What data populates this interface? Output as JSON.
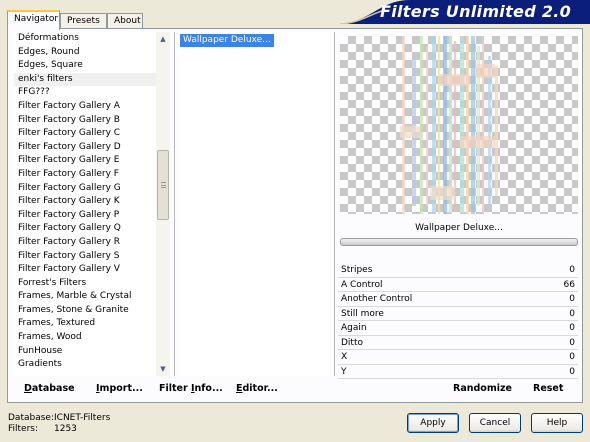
{
  "tabs": [
    {
      "label": "Navigator",
      "active": true
    },
    {
      "label": "Presets",
      "active": false
    },
    {
      "label": "About",
      "active": false
    }
  ],
  "banner": {
    "title": "Filters Unlimited 2.0",
    "color": "#0a1e7a"
  },
  "categories": [
    "Déformations",
    "Edges, Round",
    "Edges, Square",
    "enki's filters",
    "FFG???",
    "Filter Factory Gallery A",
    "Filter Factory Gallery B",
    "Filter Factory Gallery C",
    "Filter Factory Gallery D",
    "Filter Factory Gallery E",
    "Filter Factory Gallery F",
    "Filter Factory Gallery G",
    "Filter Factory Gallery K",
    "Filter Factory Gallery P",
    "Filter Factory Gallery Q",
    "Filter Factory Gallery R",
    "Filter Factory Gallery S",
    "Filter Factory Gallery V",
    "Forrest's Filters",
    "Frames, Marble & Crystal",
    "Frames, Stone & Granite",
    "Frames, Textured",
    "Frames, Wood",
    "FunHouse",
    "Gradients"
  ],
  "selected_category": "enki's filters",
  "filters": [
    "Wallpaper Deluxe..."
  ],
  "preview": {
    "caption": "Wallpaper Deluxe..."
  },
  "controls": [
    {
      "label": "Stripes",
      "value": "0"
    },
    {
      "label": "A Control",
      "value": "66"
    },
    {
      "label": "Another Control",
      "value": "0"
    },
    {
      "label": "Still more",
      "value": "0"
    },
    {
      "label": "Again",
      "value": "0"
    },
    {
      "label": "Ditto",
      "value": "0"
    },
    {
      "label": "X",
      "value": "0"
    },
    {
      "label": "Y",
      "value": "0"
    }
  ],
  "bottom_buttons": {
    "database": {
      "u": "D",
      "rest": "atabase"
    },
    "import": {
      "u": "I",
      "rest": "mport..."
    },
    "filter_info": {
      "u": "",
      "pre": "Filter ",
      "u2": "I",
      "rest": "nfo..."
    },
    "editor": {
      "u": "E",
      "rest": "ditor..."
    },
    "randomize": "Randomize",
    "reset": "Reset"
  },
  "footer": {
    "database_label": "Database:",
    "database_value": "ICNET-Filters",
    "filters_label": "Filters:",
    "filters_value": "1253"
  },
  "dialog_buttons": {
    "apply": "Apply",
    "cancel": "Cancel",
    "help": "Help"
  }
}
